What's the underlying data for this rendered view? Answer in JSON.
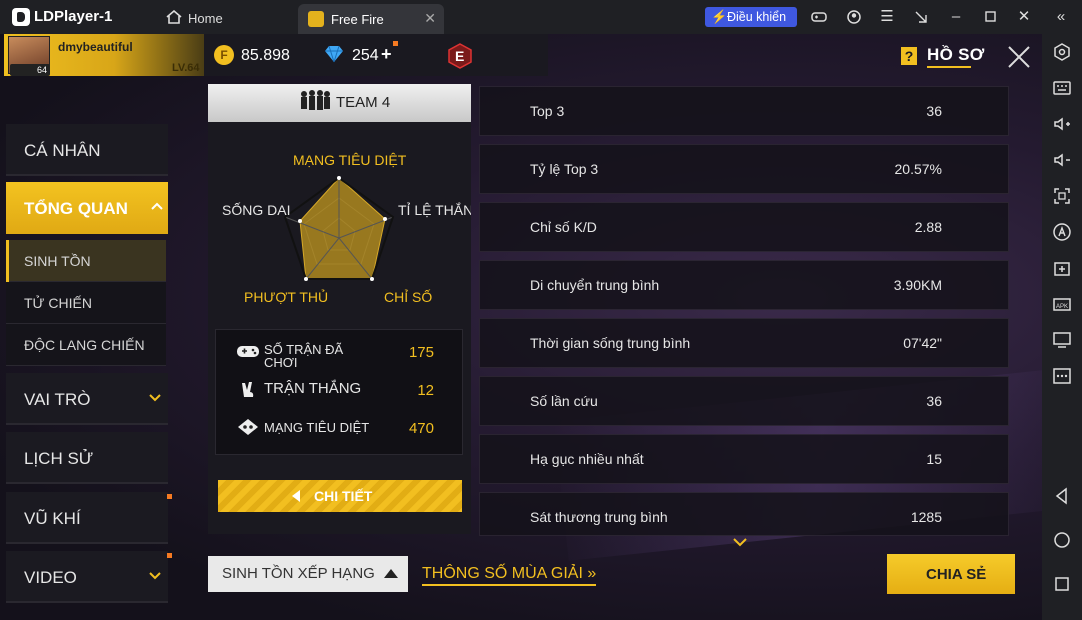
{
  "titlebar": {
    "app_name": "LDPlayer-1",
    "home_label": "Home",
    "tab_label": "Free Fire",
    "control_label": "Điều khiển"
  },
  "header": {
    "player_name": "dmybeautiful",
    "player_level": "LV.64",
    "avatar_badge": "64",
    "coins": "85.898",
    "diamonds": "254",
    "diamonds_plus": "+",
    "rank_badge": "E",
    "help_label": "?",
    "section_title": "HỒ SƠ"
  },
  "menu": {
    "items": [
      {
        "label": "CÁ NHÂN"
      },
      {
        "label": "TỔNG QUAN"
      },
      {
        "label": "VAI TRÒ"
      },
      {
        "label": "LỊCH SỬ"
      },
      {
        "label": "VŨ KHÍ"
      },
      {
        "label": "VIDEO"
      }
    ],
    "sub_items": [
      {
        "label": "SINH TỒN"
      },
      {
        "label": "TỬ CHIẾN"
      },
      {
        "label": "ĐỘC LANG CHIẾN"
      }
    ]
  },
  "team": {
    "label": "TEAM 4"
  },
  "radar": {
    "axes": [
      {
        "label": "MẠNG TIÊU DIỆT"
      },
      {
        "label": "TỈ LỆ THẮNG"
      },
      {
        "label": "CHỈ SỐ"
      },
      {
        "label": "PHƯỢT THỦ"
      },
      {
        "label": "SỐNG DAI"
      }
    ],
    "fill_color": "#b8901f"
  },
  "summary": [
    {
      "icon": "gamepad-icon",
      "label": "SỐ TRẬN ĐÃ CHƠI",
      "value": "175"
    },
    {
      "icon": "victory-icon",
      "label": "TRẬN THẮNG",
      "value": "12"
    },
    {
      "icon": "skull-icon",
      "label": "MẠNG TIÊU DIỆT",
      "value": "470"
    }
  ],
  "detail_button": "CHI TIẾT",
  "stats": [
    {
      "label": "Top 3",
      "value": "36"
    },
    {
      "label": "Tỷ lệ Top 3",
      "value": "20.57%"
    },
    {
      "label": "Chỉ số K/D",
      "value": "2.88"
    },
    {
      "label": "Di chuyển trung bình",
      "value": "3.90KM"
    },
    {
      "label": "Thời gian sống trung bình",
      "value": "07'42\""
    },
    {
      "label": "Số lần cứu",
      "value": "36"
    },
    {
      "label": "Hạ gục nhiều nhất",
      "value": "15"
    },
    {
      "label": "Sát thương trung bình",
      "value": "1285"
    }
  ],
  "bottom": {
    "rank_select": "SINH TỒN XẾP HẠNG",
    "season_link": "THÔNG SỐ MÙA GIẢI",
    "season_link_arrow": "»",
    "share_button": "CHIA SẺ"
  },
  "colors": {
    "accent": "#f2bf20",
    "notification": "#f57a22"
  }
}
